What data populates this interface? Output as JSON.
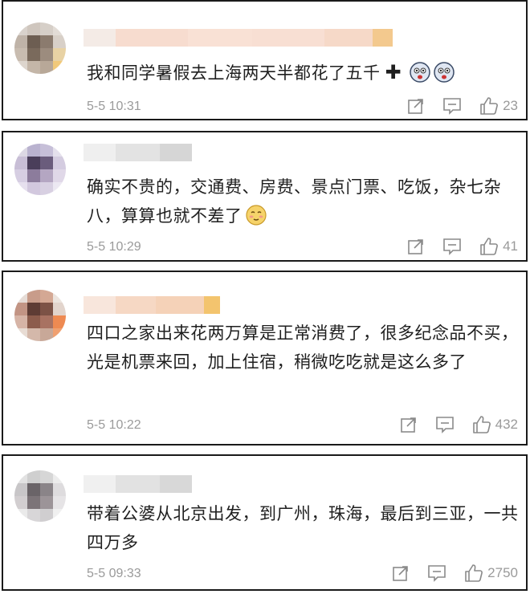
{
  "comments": [
    {
      "text": "我和同学暑假去上海两天半都花了五千",
      "time": "5-5 10:31",
      "likes": "23",
      "emojis": [
        "cross-icon",
        "scared-face-icon",
        "scared-face-icon"
      ]
    },
    {
      "text": "确实不贵的，交通费、房费、景点门票、吃饭，杂七杂八，算算也就不差了",
      "time": "5-5 10:29",
      "likes": "41",
      "emojis": [
        "shy-face-icon"
      ]
    },
    {
      "text": "四口之家出来花两万算是正常消费了，很多纪念品不买，光是机票来回，加上住宿，稍微吃吃就是这么多了",
      "time": "5-5 10:22",
      "likes": "432",
      "emojis": []
    },
    {
      "text": "带着公婆从北京出发，到广州，珠海，最后到三亚，一共四万多",
      "time": "5-5 09:33",
      "likes": "2750",
      "emojis": []
    }
  ],
  "colors": {
    "meta": "#9a9a9a",
    "border": "#1a1a1a"
  }
}
